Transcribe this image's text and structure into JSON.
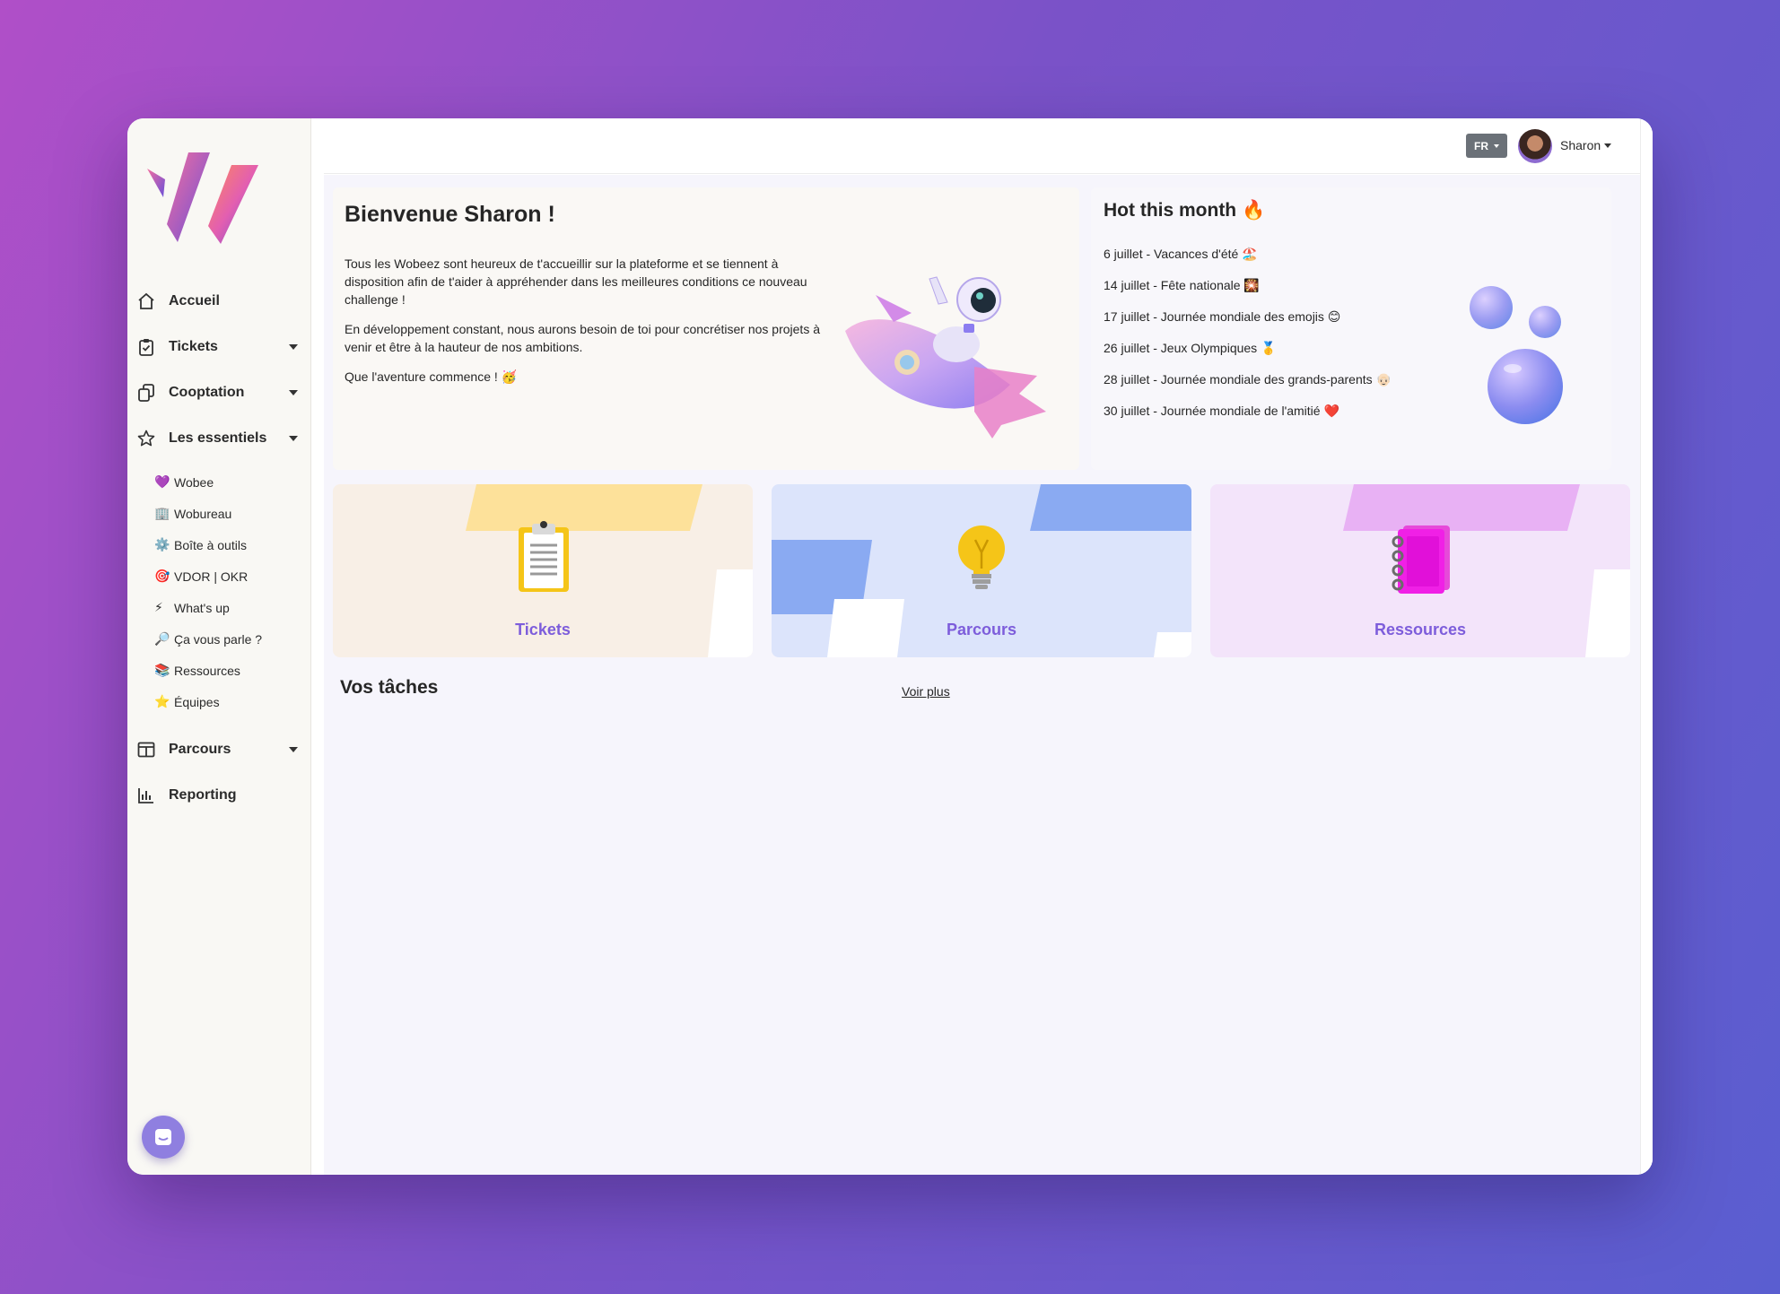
{
  "sidebar": {
    "nav": [
      {
        "label": "Accueil",
        "icon": "home-icon"
      },
      {
        "label": "Tickets",
        "icon": "clipboard-check-icon"
      },
      {
        "label": "Cooptation",
        "icon": "copy-icon"
      },
      {
        "label": "Les essentiels",
        "icon": "star-icon"
      },
      {
        "label": "Parcours",
        "icon": "layout-icon"
      },
      {
        "label": "Reporting",
        "icon": "bar-chart-icon"
      }
    ],
    "essentiels": [
      {
        "emoji": "💜",
        "label": "Wobee"
      },
      {
        "emoji": "🏢",
        "label": "Wobureau"
      },
      {
        "emoji": "⚙️",
        "label": "Boîte à outils"
      },
      {
        "emoji": "🎯",
        "label": "VDOR | OKR"
      },
      {
        "emoji": "⚡",
        "label": "What's up"
      },
      {
        "emoji": "🔎",
        "label": "Ça vous parle ?"
      },
      {
        "emoji": "📚",
        "label": "Ressources"
      },
      {
        "emoji": "⭐",
        "label": "Équipes"
      }
    ]
  },
  "topbar": {
    "language": "FR",
    "user_name": "Sharon"
  },
  "welcome": {
    "title": "Bienvenue Sharon !",
    "paragraphs": [
      "Tous les Wobeez sont heureux de t'accueillir sur la plateforme et se tiennent à disposition afin de t'aider à appréhender dans les meilleures conditions ce nouveau challenge !",
      "En développement constant, nous aurons besoin de toi pour concrétiser nos projets à venir et être à la hauteur de nos ambitions.",
      "Que l'aventure commence ! 🥳"
    ]
  },
  "hot": {
    "title": "Hot this month 🔥",
    "events": [
      "6 juillet - Vacances d'été 🏖️",
      "14 juillet - Fête nationale 🎇",
      "17 juillet - Journée mondiale des emojis 😊",
      "26 juillet - Jeux Olympiques 🥇",
      "28 juillet - Journée mondiale des grands-parents 👴🏻",
      "30 juillet - Journée mondiale de l'amitié ❤️"
    ]
  },
  "cards": [
    {
      "label": "Tickets",
      "bg": "#f8efe6",
      "accent": "#fde19a"
    },
    {
      "label": "Parcours",
      "bg": "#dce4fb",
      "accent": "#8aaaf2"
    },
    {
      "label": "Ressources",
      "bg": "#f3e4fa",
      "accent": "#e8b1f4"
    }
  ],
  "tasks": {
    "title": "Vos tâches",
    "more_label": "Voir plus"
  }
}
